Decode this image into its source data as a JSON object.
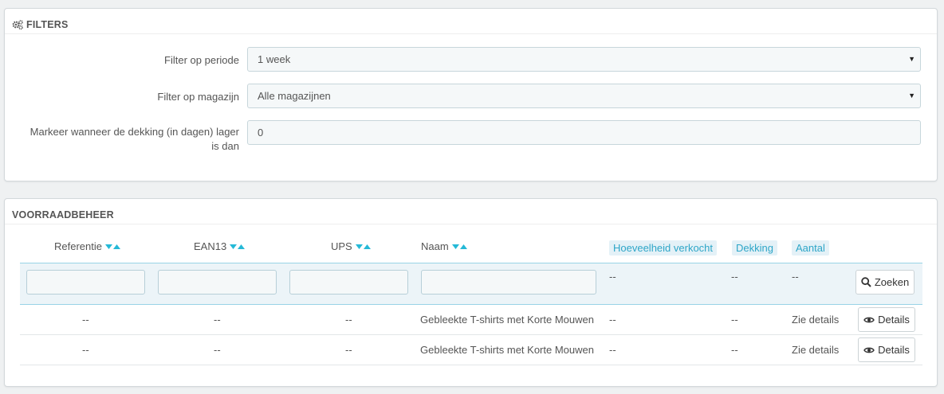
{
  "filters": {
    "title": "FILTERS",
    "period_label": "Filter op periode",
    "period_value": "1 week",
    "warehouse_label": "Filter op magazijn",
    "warehouse_value": "Alle magazijnen",
    "coverage_label_line1": "Markeer wanneer de dekking (in dagen) lager",
    "coverage_label_line2": "is dan",
    "coverage_value": "0"
  },
  "stock": {
    "title": "VOORRAADBEHEER",
    "columns": [
      "Referentie",
      "EAN13",
      "UPS",
      "Naam",
      "Hoeveelheid verkocht",
      "Dekking",
      "Aantal"
    ],
    "filter_row": {
      "sold": "--",
      "coverage": "--",
      "quantity": "--",
      "search_button": "Zoeken"
    },
    "rows": [
      {
        "reference": "--",
        "ean13": "--",
        "ups": "--",
        "name": "Gebleekte T-shirts met Korte Mouwen",
        "sold": "--",
        "coverage": "--",
        "quantity": "Zie details",
        "action": "Details"
      },
      {
        "reference": "--",
        "ean13": "--",
        "ups": "--",
        "name": "Gebleekte T-shirts met Korte Mouwen",
        "sold": "--",
        "coverage": "--",
        "quantity": "Zie details",
        "action": "Details"
      }
    ]
  },
  "colors": {
    "accent": "#25b9d7",
    "highlight_bg": "#e4f1f7",
    "filter_row_bg": "#ecf4f8"
  },
  "icons": [
    "cogs-icon",
    "sort-desc-icon",
    "sort-asc-icon",
    "search-icon",
    "eye-icon",
    "caret-down-icon"
  ]
}
